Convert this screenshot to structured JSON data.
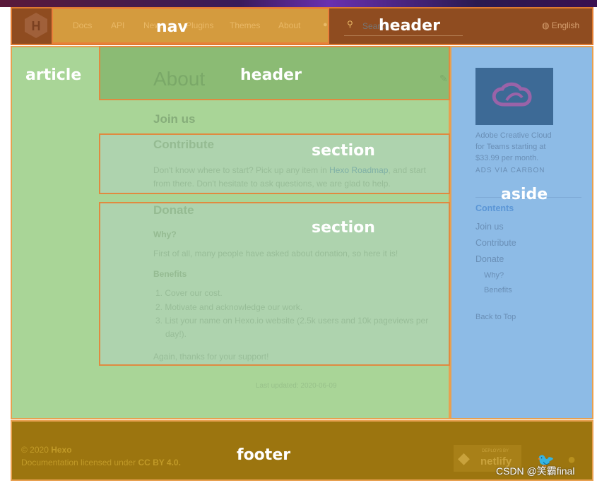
{
  "overlay_labels": {
    "nav": "nav",
    "header": "header",
    "article": "article",
    "article_header": "header",
    "section1": "section",
    "section2": "section",
    "aside": "aside",
    "footer": "footer"
  },
  "nav": {
    "items": [
      "Docs",
      "API",
      "News",
      "Plugins",
      "Themes",
      "About"
    ]
  },
  "header": {
    "search_placeholder": "Search",
    "language": "English"
  },
  "article": {
    "title": "About",
    "join_us": "Join us",
    "contribute": {
      "title": "Contribute",
      "text_before": "Don't know where to start? Pick up any item in ",
      "link": "Hexo Roadmap",
      "text_after": ", and start",
      "line2": "from there. Don't hesitate to ask questions, we are glad to help."
    },
    "donate": {
      "title": "Donate",
      "why": "Why?",
      "why_text": "First of all, many people have asked about donation, so here it is!",
      "benefits": "Benefits",
      "list": [
        "Cover our cost.",
        "Motivate and acknowledge our work.",
        "List your name on Hexo.io website (2.5k users and 10k pageviews per",
        "day!)."
      ],
      "thanks": "Again, thanks for your support!"
    },
    "last_updated": "Last updated: 2020-06-09"
  },
  "aside": {
    "ad_lines": [
      "Adobe Creative Cloud",
      "for Teams starting at",
      "$33.99 per month."
    ],
    "ad_via": "ADS VIA CARBON",
    "contents": "Contents",
    "toc": [
      "Join us",
      "Contribute",
      "Donate"
    ],
    "toc_sub": [
      "Why?",
      "Benefits"
    ],
    "back_to_top": "Back to Top"
  },
  "footer": {
    "copyright": "© 2020 ",
    "brand": "Hexo",
    "license_text": "Documentation licensed under ",
    "license": "CC BY 4.0.",
    "netlify_small": "DEPLOYS BY",
    "netlify": "netlify"
  },
  "watermark": "CSDN @笑霸final",
  "colors": {
    "header": "#8f4c20",
    "nav": "#d49b3e",
    "article": "#a9d597",
    "aside": "#8dbbe6",
    "footer": "#9c750f"
  }
}
